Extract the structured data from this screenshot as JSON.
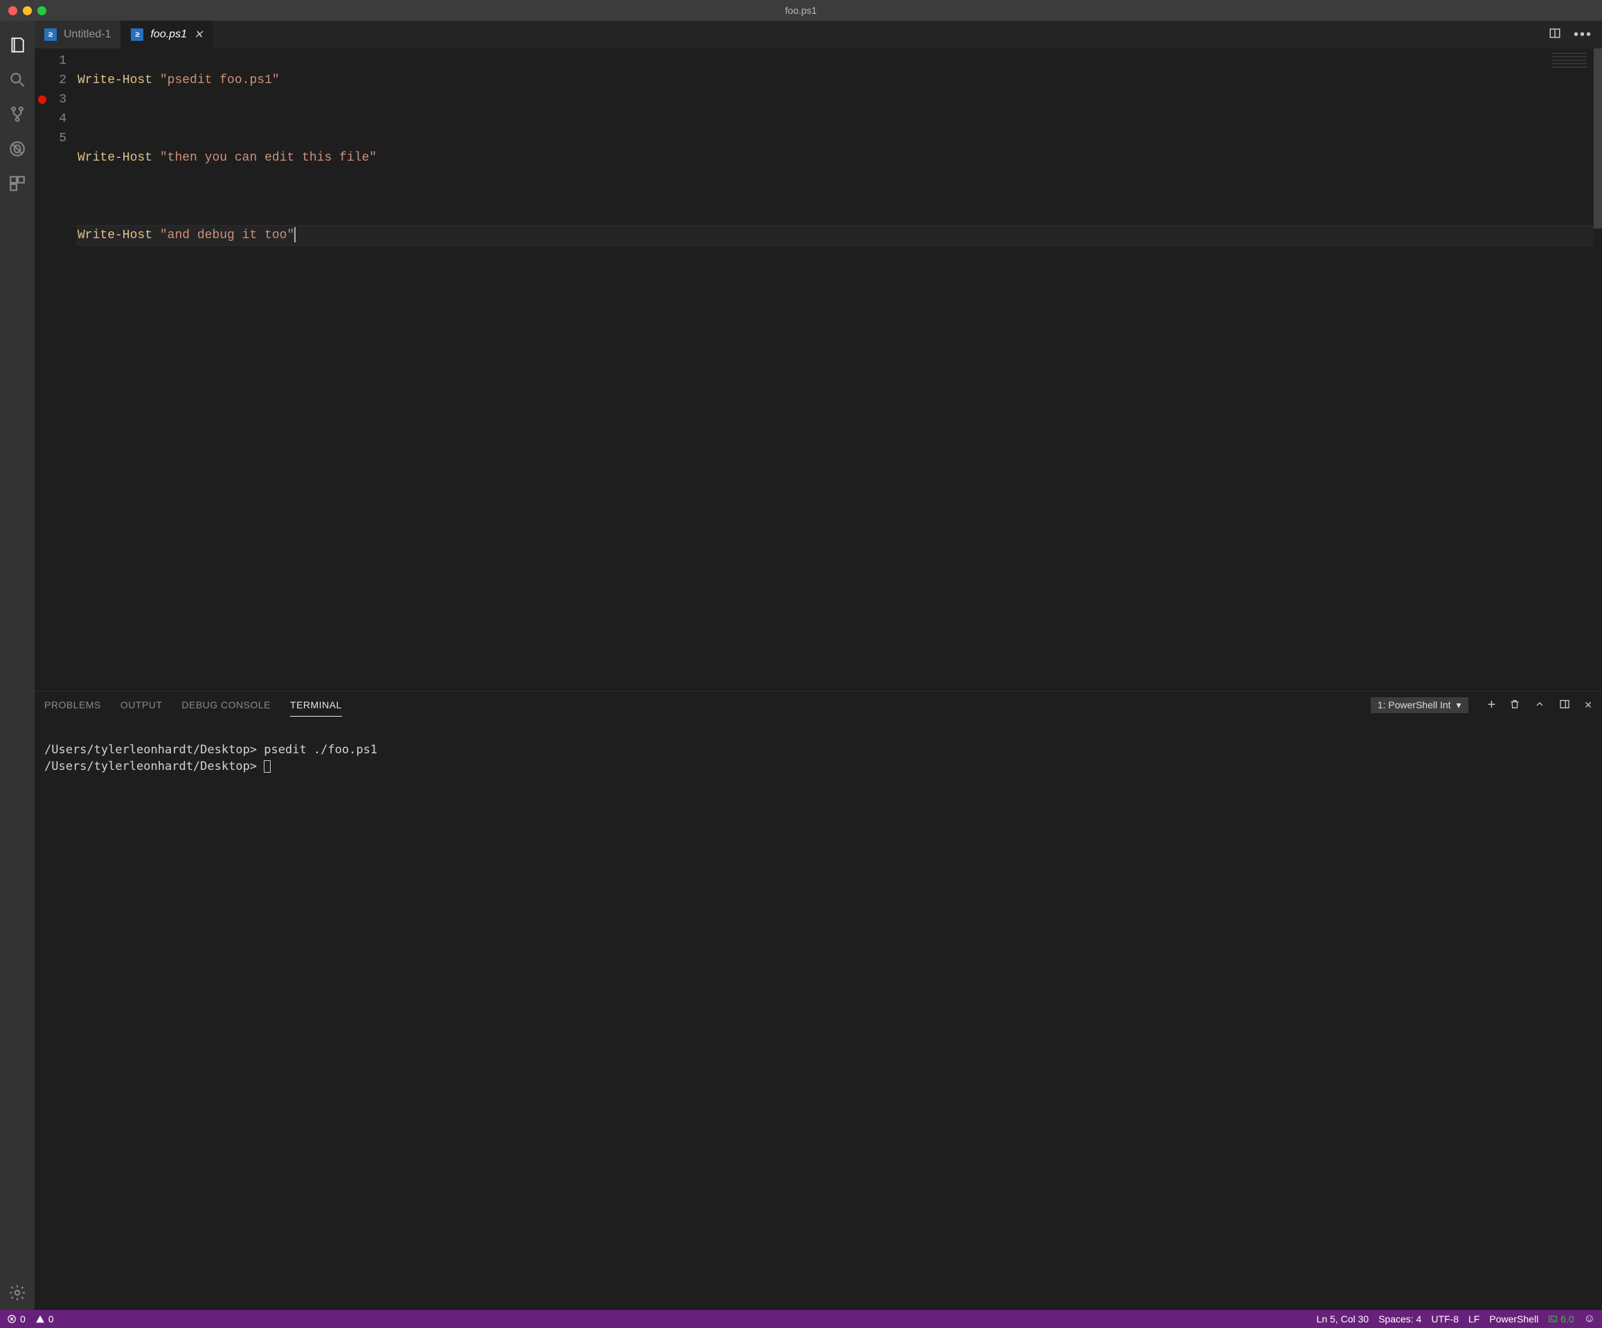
{
  "window": {
    "title": "foo.ps1"
  },
  "tabs": [
    {
      "label": "Untitled-1",
      "active": false
    },
    {
      "label": "foo.ps1",
      "active": true
    }
  ],
  "editor": {
    "lines": [
      {
        "num": "1",
        "cmd": "Write-Host",
        "str": "\"psedit foo.ps1\"",
        "bp": false
      },
      {
        "num": "2",
        "cmd": "",
        "str": "",
        "bp": false
      },
      {
        "num": "3",
        "cmd": "Write-Host",
        "str": "\"then you can edit this file\"",
        "bp": true
      },
      {
        "num": "4",
        "cmd": "",
        "str": "",
        "bp": false
      },
      {
        "num": "5",
        "cmd": "Write-Host",
        "str": "\"and debug it too\"",
        "bp": false,
        "cursor": true
      }
    ]
  },
  "panel": {
    "tabs": {
      "problems": "PROBLEMS",
      "output": "OUTPUT",
      "debug": "DEBUG CONSOLE",
      "terminal": "TERMINAL"
    },
    "terminalSelect": "1: PowerShell Int",
    "terminalLines": [
      "/Users/tylerleonhardt/Desktop> psedit ./foo.ps1",
      "/Users/tylerleonhardt/Desktop> "
    ]
  },
  "status": {
    "errors": "0",
    "warnings": "0",
    "lncol": "Ln 5, Col 30",
    "spaces": "Spaces: 4",
    "encoding": "UTF-8",
    "eol": "LF",
    "lang": "PowerShell",
    "psver": "6.0"
  }
}
